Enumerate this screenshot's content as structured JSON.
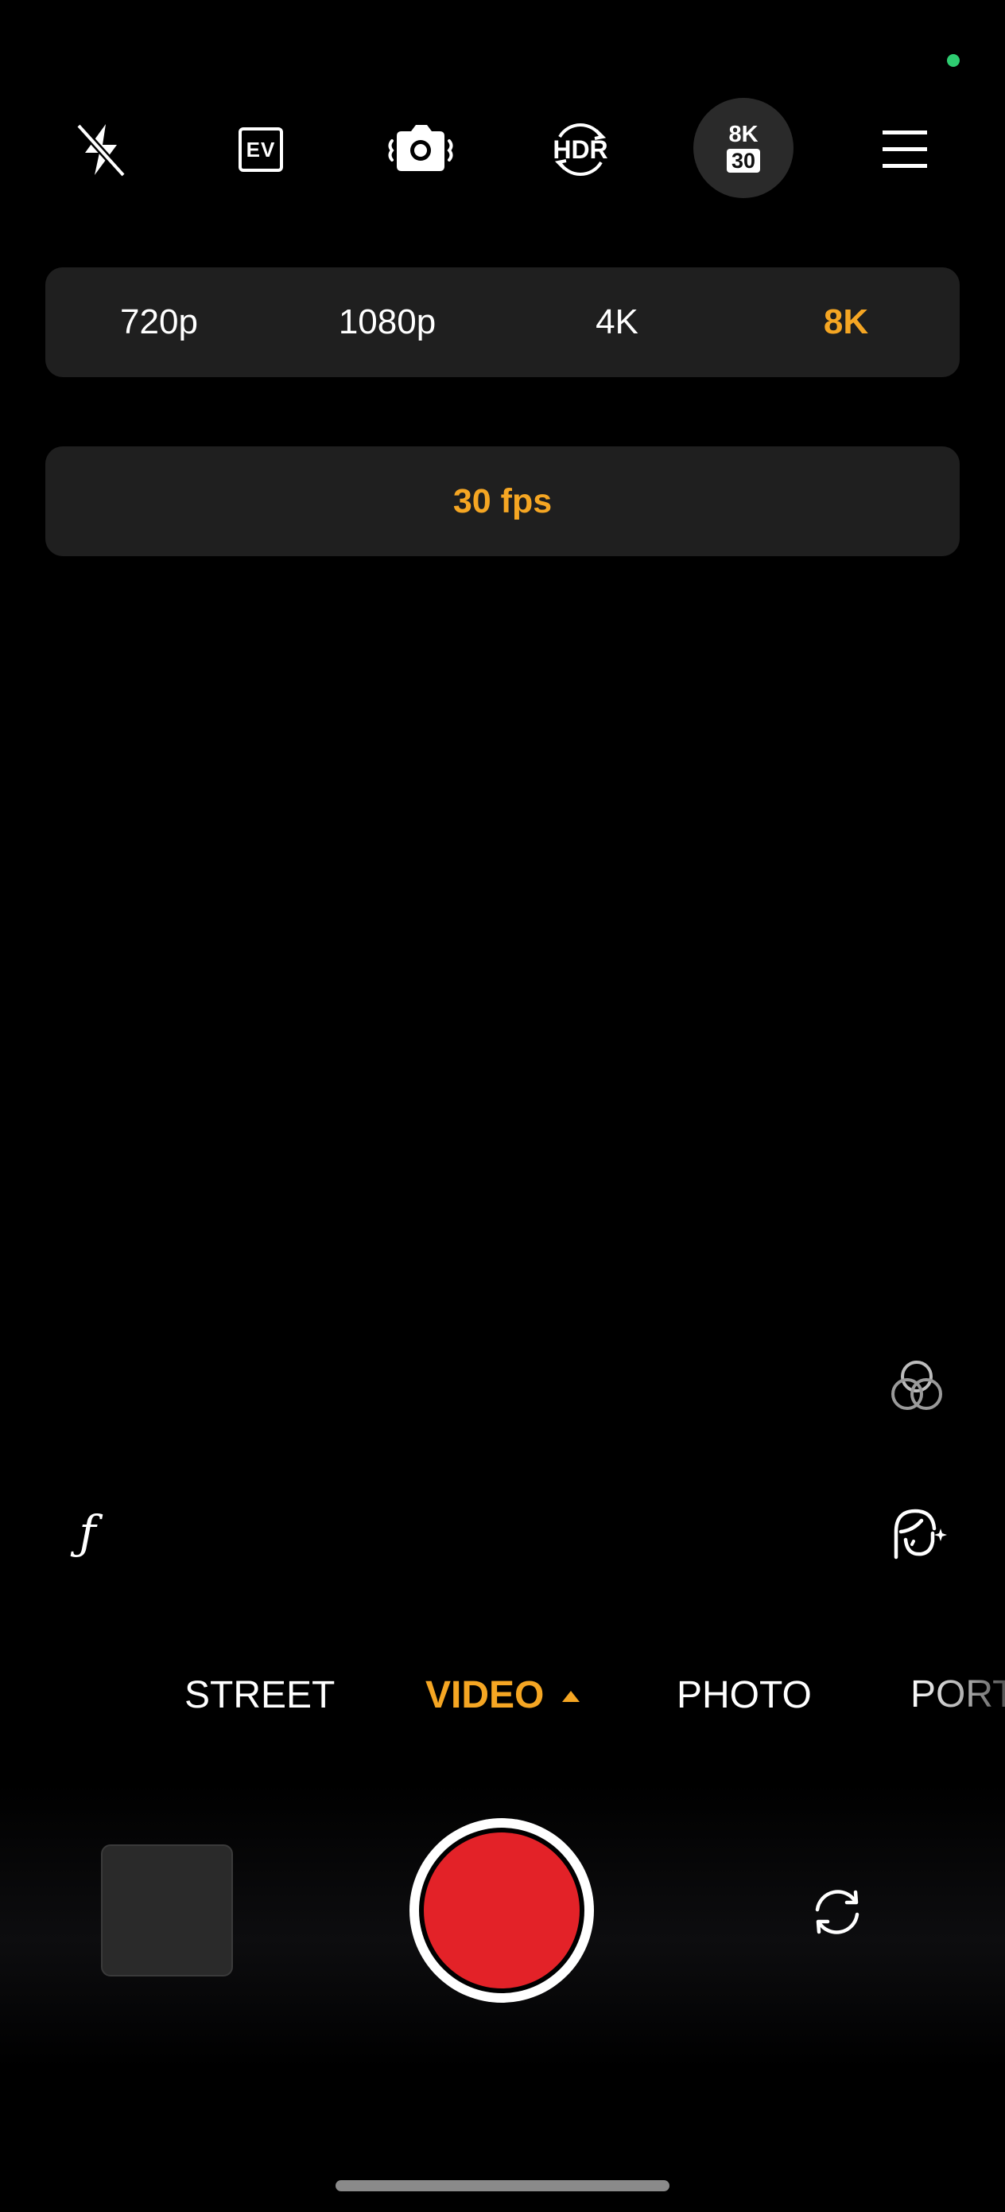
{
  "colors": {
    "accent": "#f5a623",
    "record": "#e32228",
    "status_dot": "#2ecc71"
  },
  "toolbar": {
    "flash_icon": "flash-off-icon",
    "ev_label": "EV",
    "stabilization_icon": "camera-shake-icon",
    "hdr_label": "HDR",
    "resolution_badge": {
      "resolution": "8K",
      "fps": "30"
    },
    "menu_icon": "hamburger-menu-icon"
  },
  "resolution_options": {
    "options": [
      "720p",
      "1080p",
      "4K",
      "8K"
    ],
    "selected": "8K"
  },
  "fps_options": {
    "options": [
      "30 fps"
    ],
    "selected": "30 fps"
  },
  "side_controls": {
    "filters_icon": "color-filters-icon",
    "aperture_label": "ƒ",
    "beauty_icon": "face-retouch-icon"
  },
  "modes": {
    "items": [
      "STREET",
      "VIDEO",
      "PHOTO",
      "PORT"
    ],
    "selected": "VIDEO"
  },
  "bottom_controls": {
    "gallery_icon": "gallery-thumbnail",
    "shutter_icon": "record-button",
    "flip_icon": "switch-camera-icon"
  }
}
